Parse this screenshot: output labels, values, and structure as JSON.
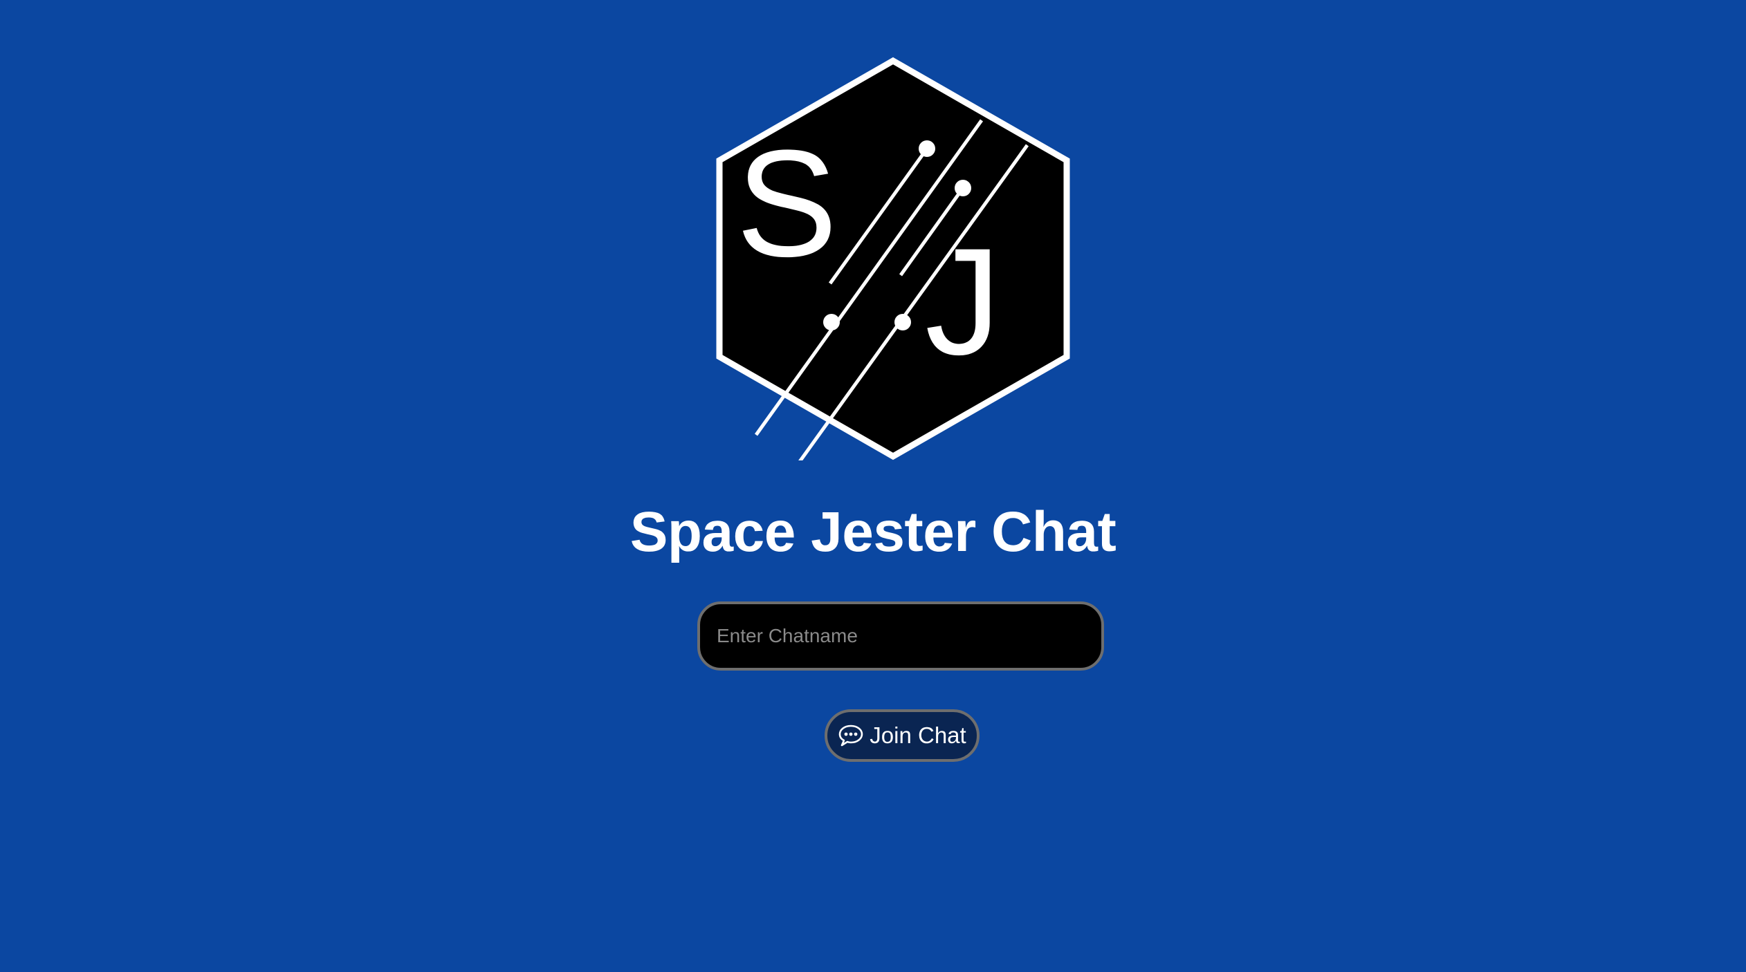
{
  "logo": {
    "letter_left": "S",
    "letter_right": "J"
  },
  "title": "Space Jester Chat",
  "chatname_input": {
    "placeholder": "Enter Chatname",
    "value": ""
  },
  "join_button": {
    "label": "Join Chat",
    "icon": "chat-bubble-icon"
  },
  "colors": {
    "background": "#0b47a1",
    "input_background": "#000000",
    "button_background": "#0a2552",
    "border": "#6e6e6e",
    "text": "#ffffff"
  }
}
